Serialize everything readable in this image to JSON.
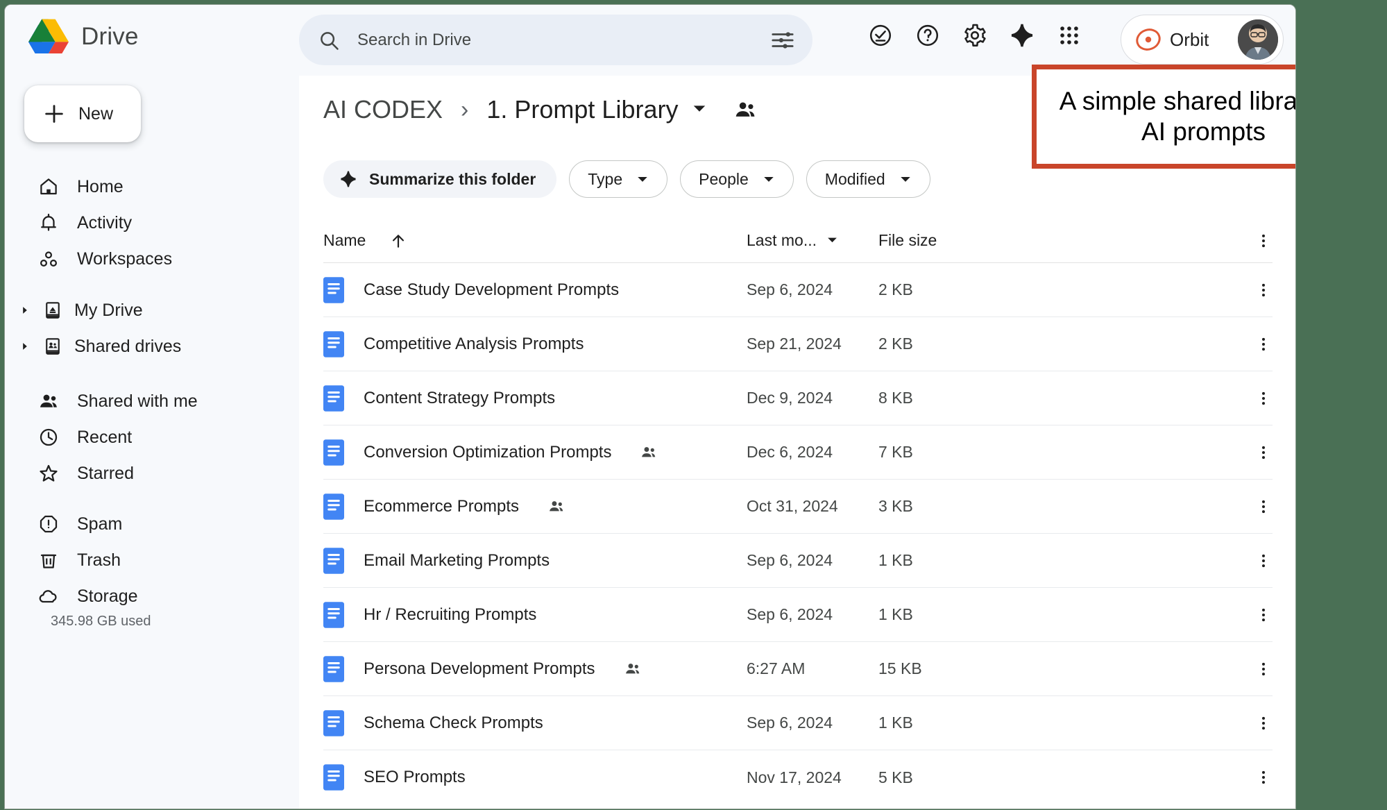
{
  "app": {
    "brand": "Drive",
    "logo_colors": {
      "green": "#188038",
      "yellow": "#fbbc04",
      "blue": "#1a73e8",
      "red": "#ea4335"
    }
  },
  "search": {
    "placeholder": "Search in Drive",
    "value": "",
    "search_icon": "search-icon",
    "filter_icon": "tune-filter-icon"
  },
  "top_actions": [
    {
      "name": "support-status-icon",
      "icon": "check-circle-icon"
    },
    {
      "name": "help-icon",
      "icon": "question-circle-icon"
    },
    {
      "name": "settings-icon",
      "icon": "gear-icon"
    },
    {
      "name": "gemini-icon",
      "icon": "sparkle-icon"
    },
    {
      "name": "google-apps-icon",
      "icon": "grid-apps-icon"
    }
  ],
  "account": {
    "label": "Orbit",
    "orbit_icon": "orbit-circle-icon",
    "avatar_name": "user-avatar"
  },
  "sidebar": {
    "new_button": {
      "label": "New",
      "icon": "plus-icon"
    },
    "primary_items": [
      {
        "label": "Home",
        "icon": "home-icon"
      },
      {
        "label": "Activity",
        "icon": "bell-icon"
      },
      {
        "label": "Workspaces",
        "icon": "workspaces-icon"
      }
    ],
    "tree_items": [
      {
        "label": "My Drive",
        "icon": "my-drive-icon",
        "caret": "caret-right-icon"
      },
      {
        "label": "Shared drives",
        "icon": "shared-drives-icon",
        "caret": "caret-right-icon"
      }
    ],
    "secondary_items": [
      {
        "label": "Shared with me",
        "icon": "people-icon"
      },
      {
        "label": "Recent",
        "icon": "clock-icon"
      },
      {
        "label": "Starred",
        "icon": "star-icon"
      }
    ],
    "tertiary_items": [
      {
        "label": "Spam",
        "icon": "octagon-alert-icon"
      },
      {
        "label": "Trash",
        "icon": "trash-icon"
      },
      {
        "label": "Storage",
        "icon": "cloud-icon"
      }
    ],
    "storage_used": "345.98 GB used"
  },
  "breadcrumb": {
    "root": "AI CODEX",
    "separator": "›",
    "current": "1. Prompt Library",
    "caret_icon": "caret-down-icon",
    "share_icon": "people-share-icon"
  },
  "chips": {
    "summarize": {
      "label": "Summarize this folder",
      "icon": "sparkle-icon"
    },
    "type": {
      "label": "Type",
      "caret": "caret-down-icon"
    },
    "people": {
      "label": "People",
      "caret": "caret-down-icon"
    },
    "modified": {
      "label": "Modified",
      "caret": "caret-down-icon"
    }
  },
  "table": {
    "headers": {
      "name": "Name",
      "name_sort_icon": "arrow-up-icon",
      "modified": "Last mo...",
      "modified_caret": "caret-down-icon",
      "size": "File size",
      "more_icon": "more-vertical-icon"
    },
    "rows": [
      {
        "name": "Case Study Development Prompts",
        "shared": false,
        "modified": "Sep 6, 2024",
        "size": "2 KB"
      },
      {
        "name": "Competitive Analysis Prompts",
        "shared": false,
        "modified": "Sep 21, 2024",
        "size": "2 KB"
      },
      {
        "name": "Content Strategy Prompts",
        "shared": false,
        "modified": "Dec 9, 2024",
        "size": "8 KB"
      },
      {
        "name": "Conversion Optimization Prompts",
        "shared": true,
        "modified": "Dec 6, 2024",
        "size": "7 KB"
      },
      {
        "name": "Ecommerce Prompts",
        "shared": true,
        "modified": "Oct 31, 2024",
        "size": "3 KB"
      },
      {
        "name": "Email Marketing Prompts",
        "shared": false,
        "modified": "Sep 6, 2024",
        "size": "1 KB"
      },
      {
        "name": "Hr / Recruiting Prompts",
        "shared": false,
        "modified": "Sep 6, 2024",
        "size": "1 KB"
      },
      {
        "name": "Persona Development Prompts",
        "shared": true,
        "modified": "6:27 AM",
        "size": "15 KB"
      },
      {
        "name": "Schema Check Prompts",
        "shared": false,
        "modified": "Sep 6, 2024",
        "size": "1 KB"
      },
      {
        "name": "SEO Prompts",
        "shared": false,
        "modified": "Nov 17, 2024",
        "size": "5 KB"
      }
    ]
  },
  "callout": {
    "text": "A simple shared library of AI prompts",
    "border_color": "#c9452a",
    "background_color": "#ffffff"
  },
  "colors": {
    "page_background": "#4a7055",
    "surface": "#ffffff",
    "sidebar_background": "#f7f9fc",
    "search_background": "#e9eef6",
    "doc_icon_blue": "#4285f4",
    "text_primary": "#1f1f1f",
    "text_secondary": "#444746"
  }
}
